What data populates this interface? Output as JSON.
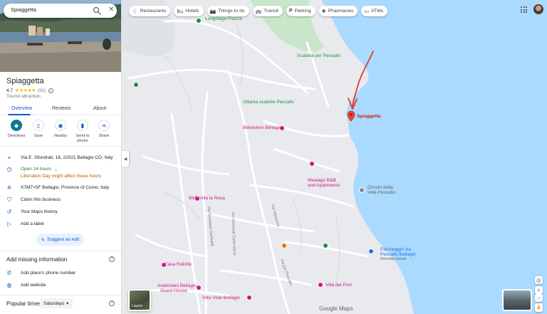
{
  "search": {
    "value": "Spiaggetta"
  },
  "place": {
    "name": "Spiaggetta",
    "rating": "4.7",
    "stars": "★★★★★",
    "reviews_count": "(91)",
    "category": "Tourist attraction"
  },
  "tabs": [
    {
      "label": "Overview",
      "active": true
    },
    {
      "label": "Reviews"
    },
    {
      "label": "About"
    }
  ],
  "actions": [
    {
      "label": "Directions"
    },
    {
      "label": "Save"
    },
    {
      "label": "Nearby"
    },
    {
      "label": "Send to phone"
    },
    {
      "label": "Share"
    }
  ],
  "details": {
    "address": "Via E. Sfondrati, 18, 22021 Bellagio CO, Italy",
    "hours": "Open 24 hours",
    "hours_note": "Liberation Day might affect these hours",
    "plus_code": "X7M7+5F Bellagio, Province of Como, Italy",
    "claim": "Claim this business",
    "history": "Your Maps history",
    "label": "Add a label"
  },
  "suggest_edit": "Suggest an edit",
  "missing": {
    "title": "Add missing information",
    "phone": "Add place's phone number",
    "website": "Add website"
  },
  "popular": {
    "title": "Popular times",
    "day": "Saturdays"
  },
  "chips": [
    {
      "label": "Restaurants",
      "icon": "fork-knife-icon",
      "glyph": "🍴"
    },
    {
      "label": "Hotels",
      "icon": "bed-icon",
      "glyph": "🛏"
    },
    {
      "label": "Things to do",
      "icon": "camera-icon",
      "glyph": "📷"
    },
    {
      "label": "Transit",
      "icon": "bus-icon",
      "glyph": "🚌"
    },
    {
      "label": "Parking",
      "icon": "parking-icon",
      "glyph": "P"
    },
    {
      "label": "Pharmacies",
      "icon": "pharmacy-icon",
      "glyph": "✚"
    },
    {
      "label": "ATMs",
      "icon": "atm-icon",
      "glyph": "▭"
    }
  ],
  "map": {
    "labels": {
      "lungolago": "Lungolago Piazza",
      "scaletta": "Scaletta per Pescallo",
      "ottanta": "Ottanta scalette Pescallo",
      "belvedere": "Belvedere Bellagio",
      "spiaggetta": "Spiaggetta",
      "miralago1": "Miralago B&B",
      "miralago2": "and Apartments",
      "circolo1": "Circolo della",
      "circolo2": "Vela Pescallo",
      "villa_la_rosa": "B&B Villa la Rosa",
      "casa_felicita": "Casa Felicità",
      "parcheggio1": "Parcheggio via",
      "parcheggio2": "Pescallo Bellagio",
      "parcheggio3": "Recently viewed",
      "andirivieni1": "Andirivieni Bellagio",
      "andirivieni2": "Guest House",
      "villa_vitali": "Villa Vitali Bellagio",
      "villa_fiori": "Villa dei Fiori",
      "via_valassina": "Via Valassina",
      "via_garibaldi": "Via Giuseppe Garibaldi",
      "via_carlo": "Via Generale Carlo Monti",
      "via_pescallo": "Via per Pescallo"
    },
    "layers_label": "Layers",
    "zoom_in": "+",
    "zoom_out": "−",
    "attribution": "Google Maps",
    "colors": {
      "water": "#aadaff",
      "land": "#e8eaed",
      "park": "#c8e6c9",
      "road": "#ffffff",
      "pin": "#ea4335",
      "arrow": "#e53935"
    }
  }
}
